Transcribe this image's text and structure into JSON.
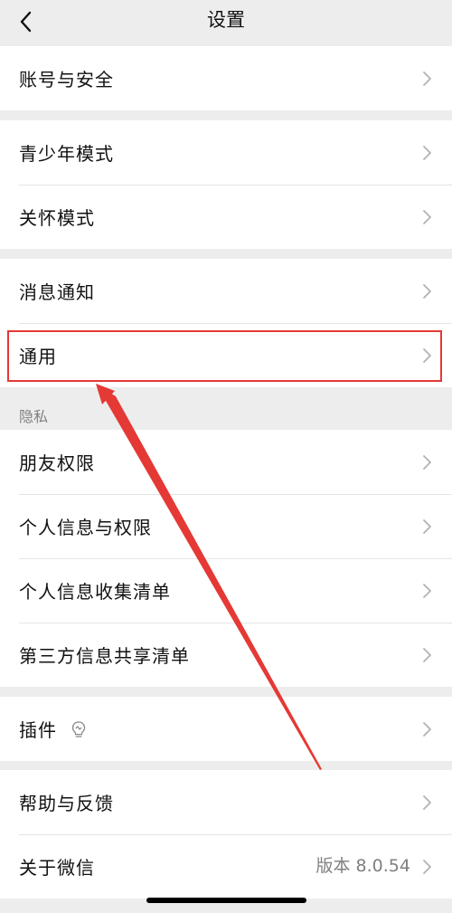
{
  "nav": {
    "title": "设置"
  },
  "groups": {
    "account": {
      "items": [
        {
          "label": "账号与安全"
        }
      ]
    },
    "modes": {
      "items": [
        {
          "label": "青少年模式"
        },
        {
          "label": "关怀模式"
        }
      ]
    },
    "general": {
      "items": [
        {
          "label": "消息通知"
        },
        {
          "label": "通用"
        }
      ]
    },
    "privacy": {
      "section_label": "隐私",
      "items": [
        {
          "label": "朋友权限"
        },
        {
          "label": "个人信息与权限"
        },
        {
          "label": "个人信息收集清单"
        },
        {
          "label": "第三方信息共享清单"
        }
      ]
    },
    "plugins": {
      "items": [
        {
          "label": "插件",
          "icon": "lightbulb-icon"
        }
      ]
    },
    "about": {
      "items": [
        {
          "label": "帮助与反馈"
        },
        {
          "label": "关于微信",
          "value": "版本 8.0.54"
        }
      ]
    }
  },
  "annotation": {
    "highlighted_item": "通用",
    "color": "#e53935"
  },
  "colors": {
    "background": "#ededed",
    "card": "#ffffff",
    "chevron": "#b2b2b2",
    "secondary_text": "#7f7f7f"
  }
}
